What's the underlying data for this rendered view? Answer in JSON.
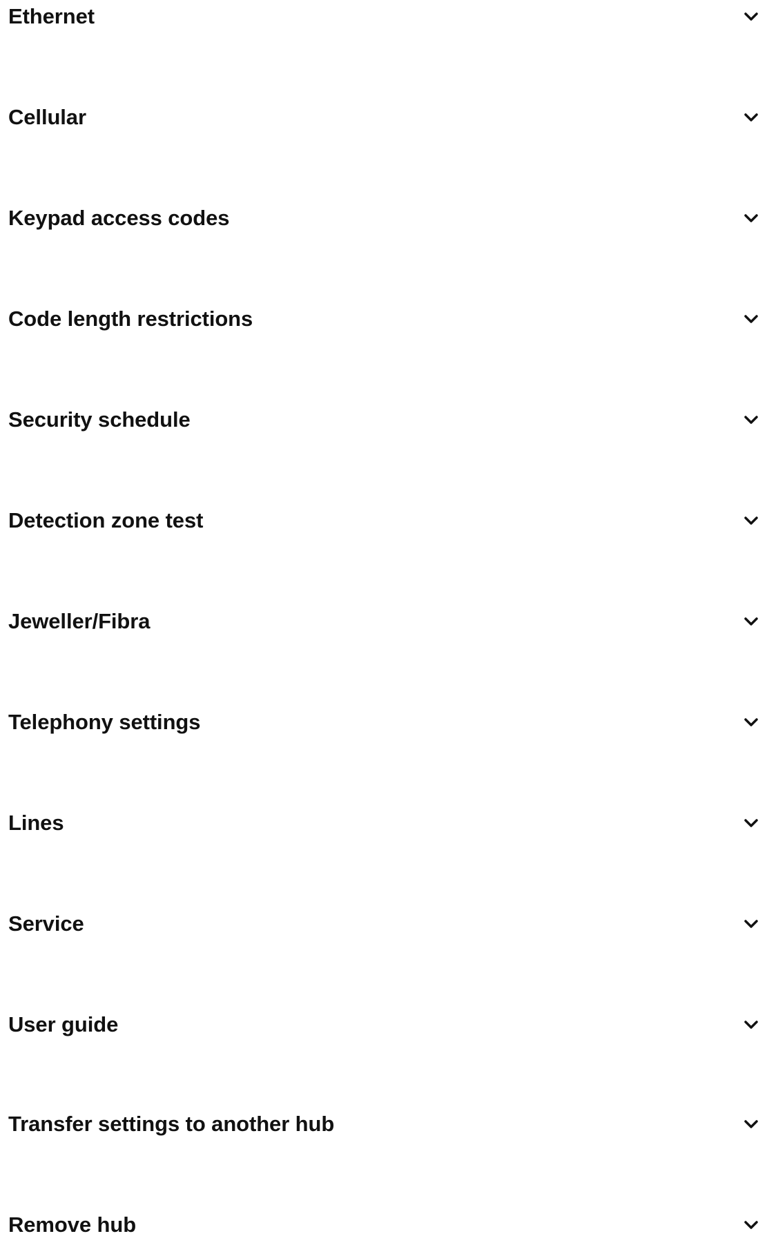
{
  "settings": {
    "items": [
      {
        "label": "Ethernet",
        "icon": "chevron-down-icon"
      },
      {
        "label": "Cellular",
        "icon": "chevron-down-icon"
      },
      {
        "label": "Keypad access codes",
        "icon": "chevron-down-icon"
      },
      {
        "label": "Code length restrictions",
        "icon": "chevron-down-icon"
      },
      {
        "label": "Security schedule",
        "icon": "chevron-down-icon"
      },
      {
        "label": "Detection zone test",
        "icon": "chevron-down-icon"
      },
      {
        "label": "Jeweller/Fibra",
        "icon": "chevron-down-icon"
      },
      {
        "label": "Telephony settings",
        "icon": "chevron-down-icon"
      },
      {
        "label": "Lines",
        "icon": "chevron-down-icon"
      },
      {
        "label": "Service",
        "icon": "chevron-down-icon"
      },
      {
        "label": "User guide",
        "icon": "chevron-down-icon"
      },
      {
        "label": "Transfer settings to another hub",
        "icon": "chevron-down-icon"
      },
      {
        "label": "Remove hub",
        "icon": "chevron-down-icon"
      }
    ]
  }
}
